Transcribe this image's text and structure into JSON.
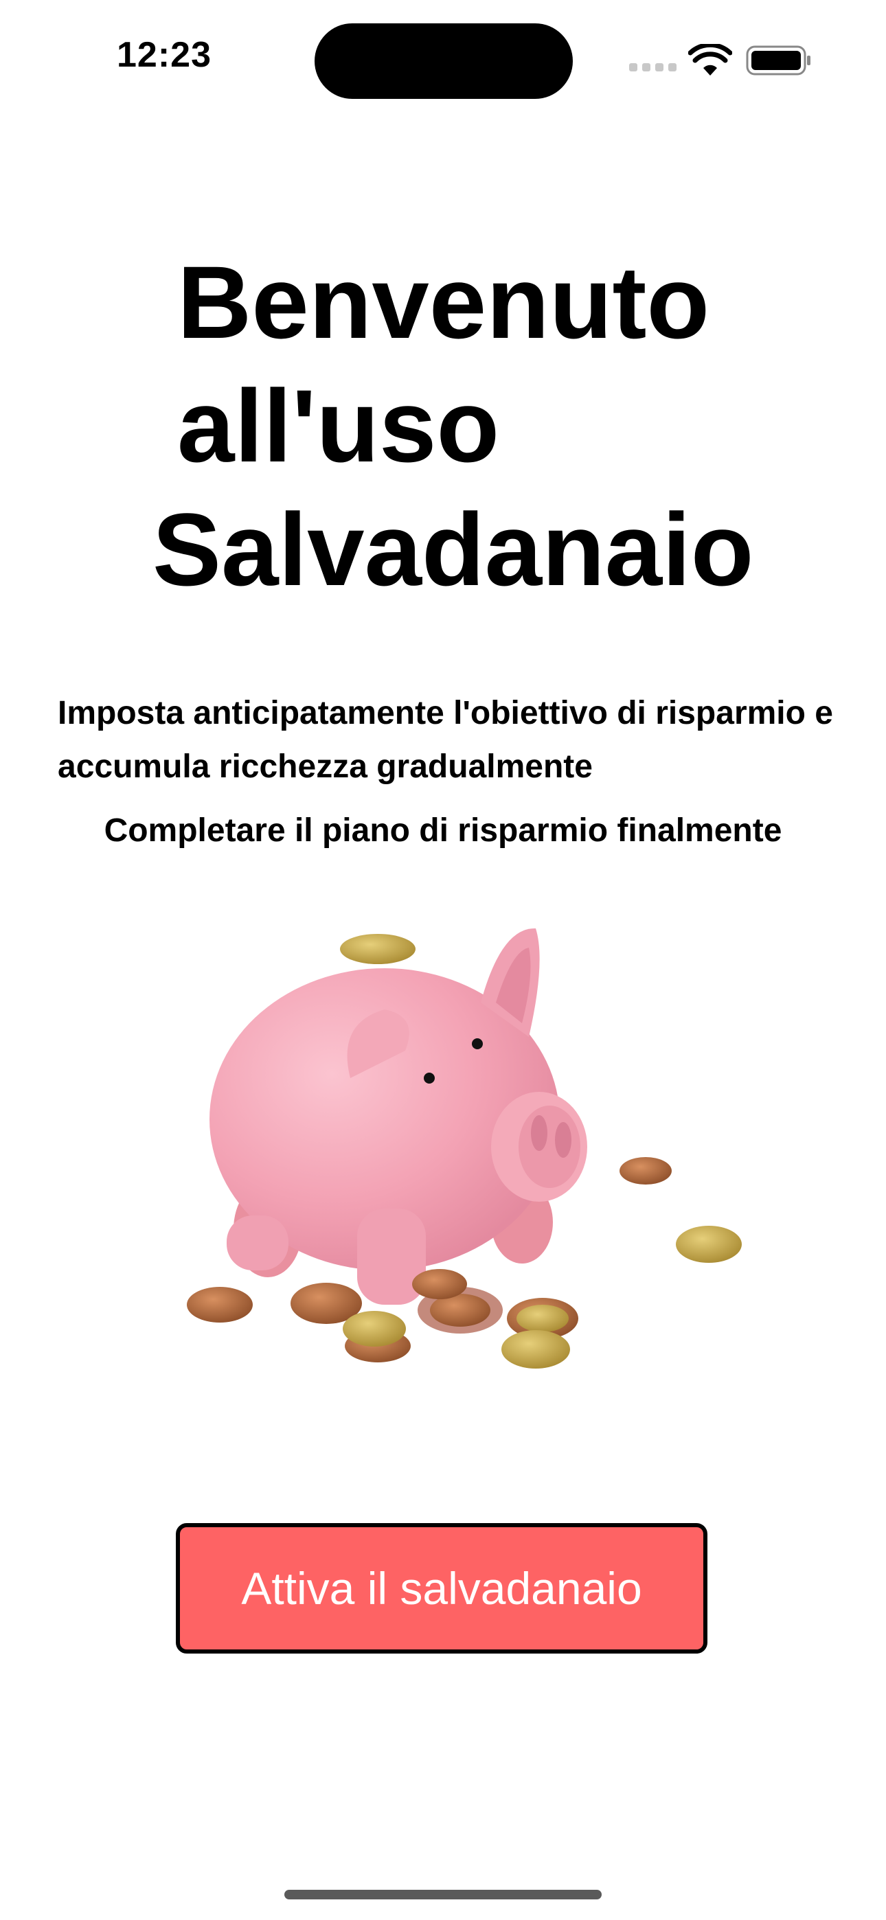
{
  "status_bar": {
    "time": "12:23",
    "signal_icon": "cellular-signal-icon",
    "wifi_icon": "wifi-icon",
    "battery_icon": "battery-icon"
  },
  "welcome": {
    "title_line1": "Benvenuto",
    "title_line2": "all'uso",
    "title_line3": "Salvadanaio",
    "description": "Imposta anticipatamente l'obiettivo di risparmio e accumula ricchezza gradualmente",
    "subdescription": "Completare il piano di risparmio finalmente",
    "illustration_icon": "piggy-bank-icon"
  },
  "actions": {
    "activate_label": "Attiva il salvadanaio"
  },
  "colors": {
    "accent": "#fe6364",
    "piggy_pink": "#f5a8b8",
    "coin_copper": "#b06a3c",
    "coin_gold": "#c9ac4e"
  }
}
